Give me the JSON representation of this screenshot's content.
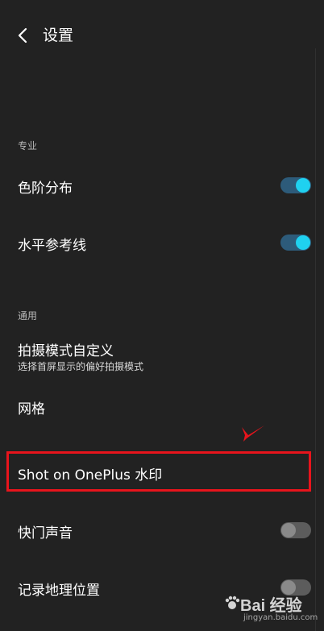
{
  "header": {
    "title": "设置",
    "back_icon": "chevron-left-icon"
  },
  "sections": {
    "pro": "专业",
    "general": "通用"
  },
  "rows": {
    "levels": {
      "label": "色阶分布",
      "toggle": "on"
    },
    "horizon": {
      "label": "水平参考线",
      "toggle": "on"
    },
    "custom_mode": {
      "label": "拍摄模式自定义",
      "sub": "选择首屏显示的偏好拍摄模式"
    },
    "grid": {
      "label": "网格"
    },
    "watermark": {
      "label": "Shot on OnePlus 水印"
    },
    "shutter_sound": {
      "label": "快门声音",
      "toggle": "off"
    },
    "location": {
      "label": "记录地理位置",
      "toggle": "off"
    }
  },
  "annotation": {
    "highlight_color": "#e8141c",
    "arrow_icon": "pointer-arrow-icon"
  },
  "site_watermark": {
    "logo": "Bai 经验",
    "url": "jingyan.baidu.com"
  },
  "colors": {
    "background": "#222222",
    "toggle_on_knob": "#1fd1f0",
    "toggle_on_track": "#2d5b7a",
    "toggle_off_track": "#5c5c5c"
  }
}
